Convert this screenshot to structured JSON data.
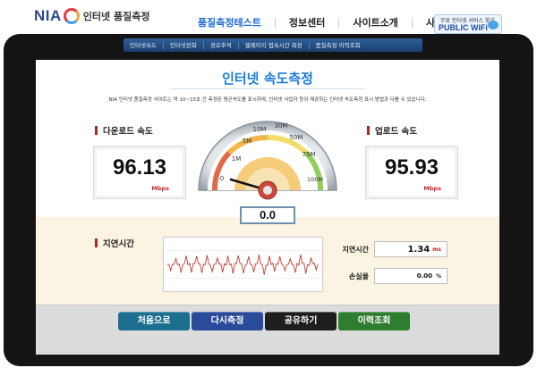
{
  "header": {
    "logo_text": "NIA",
    "logo_sub": "인터넷 품질측정",
    "nav": [
      {
        "label": "품질측정테스트",
        "active": true
      },
      {
        "label": "정보센터",
        "active": false
      },
      {
        "label": "사이트소개",
        "active": false
      },
      {
        "label": "사이트맵",
        "active": false
      }
    ],
    "banner": {
      "line1": "무료 인터넷 서비스 찾기",
      "line2": "PUBLIC WiFi",
      "badge": "Free"
    }
  },
  "subnav": [
    "인터넷속도",
    "인터넷전화",
    "경로추적",
    "웹페이지 접속시간 측정",
    "품질측정 이력조회"
  ],
  "screen": {
    "title": "인터넷 속도측정",
    "description": "NIA 인터넷 품질측정 사이트는 약 10~15초 간 측정된 평균속도를 표시하며, 인터넷 사업자 등이 제공하는 인터넷 속도측정 표시 방법과 다를 수 있습니다.",
    "download": {
      "label": "다운로드 속도",
      "value": "96.13",
      "unit": "Mbps"
    },
    "upload": {
      "label": "업로드 속도",
      "value": "95.93",
      "unit": "Mbps"
    },
    "gauge": {
      "ticks": [
        "0",
        "1M",
        "5M",
        "10M",
        "30M",
        "50M",
        "75M",
        "100M"
      ],
      "reading": "0.0",
      "needle_value": 0
    },
    "latency": {
      "label": "지연시간",
      "delay_label": "지연시간",
      "delay_value": "1.34",
      "delay_unit": "ms",
      "loss_label": "손실율",
      "loss_value": "0.00",
      "loss_unit": "%"
    },
    "buttons": [
      {
        "label": "처음으로",
        "color": "#1d6f8f"
      },
      {
        "label": "다시측정",
        "color": "#2a4a9a"
      },
      {
        "label": "공유하기",
        "color": "#1e1e1e"
      },
      {
        "label": "이력조회",
        "color": "#2f7d2f"
      }
    ]
  },
  "colors": {
    "accent": "#1a7bd6",
    "unit_red": "#c62828",
    "frame": "#141414"
  }
}
